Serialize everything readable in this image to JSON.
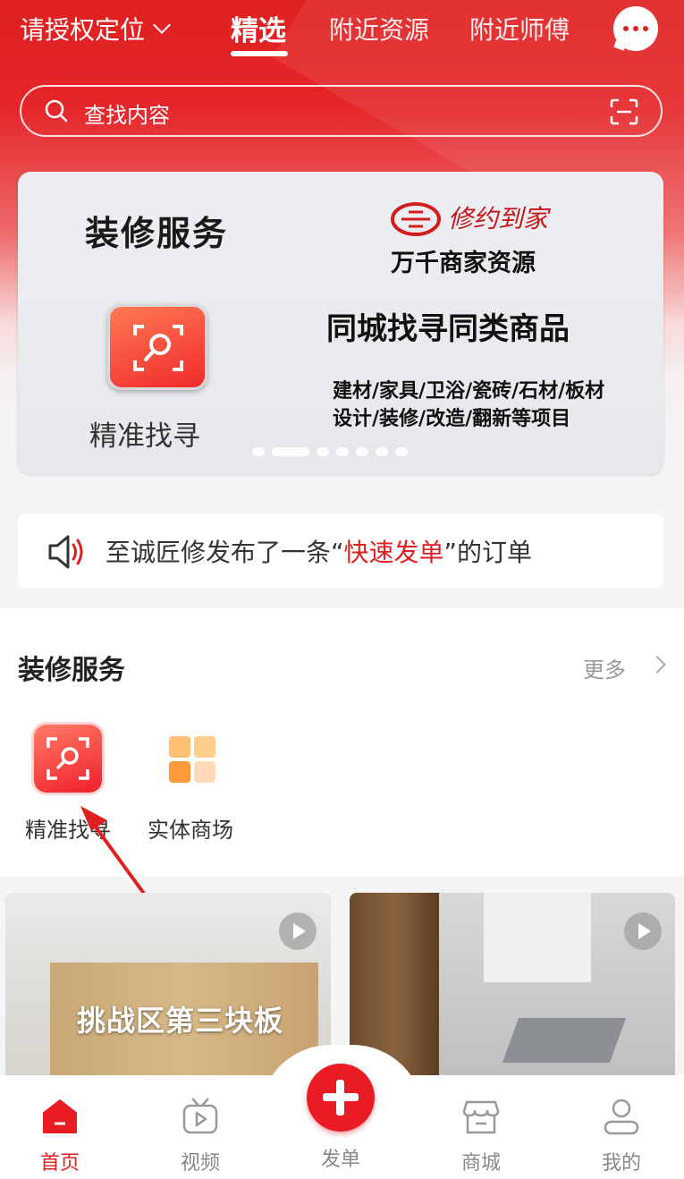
{
  "header": {
    "location_label": "请授权定位",
    "tabs": [
      {
        "label": "精选",
        "active": true
      },
      {
        "label": "附近资源",
        "active": false
      },
      {
        "label": "附近师傅",
        "active": false
      }
    ]
  },
  "search": {
    "placeholder": "查找内容"
  },
  "banner": {
    "title": "装修服务",
    "icon_label": "精准找寻",
    "brand_logo_text": "修约到家",
    "merchant": "万千商家资源",
    "headline": "同城找寻同类商品",
    "line1": "建材/家具/卫浴/瓷砖/石材/板材",
    "line2": "设计/装修/改造/翻新等项目",
    "active_slide": 2,
    "slide_count": 8
  },
  "notice": {
    "prefix": "至诚匠修发布了一条“",
    "highlight": "快速发单",
    "suffix": "”的订单"
  },
  "services": {
    "title": "装修服务",
    "more": "更多",
    "items": [
      {
        "label": "精准找寻",
        "icon": "magnify-scan-icon"
      },
      {
        "label": "实体商场",
        "icon": "grid-icon"
      }
    ]
  },
  "videos": [
    {
      "caption": "挑战区第三块板"
    },
    {
      "caption": ""
    }
  ],
  "tabbar": {
    "items": [
      {
        "label": "首页",
        "icon": "home-icon",
        "active": true
      },
      {
        "label": "视频",
        "icon": "tv-play-icon",
        "active": false
      },
      {
        "label": "发单",
        "icon": "plus-icon",
        "active": false
      },
      {
        "label": "商城",
        "icon": "shop-icon",
        "active": false
      },
      {
        "label": "我的",
        "icon": "user-icon",
        "active": false
      }
    ]
  },
  "colors": {
    "primary": "#e02020",
    "accent_orange": "#ff9a3c"
  }
}
